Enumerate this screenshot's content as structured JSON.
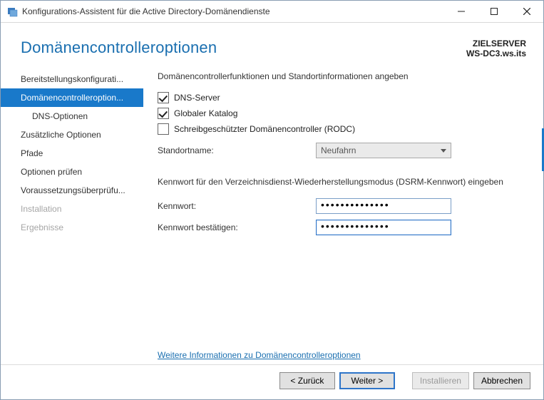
{
  "window": {
    "title": "Konfigurations-Assistent für die Active Directory-Domänendienste"
  },
  "header": {
    "title": "Domänencontrolleroptionen",
    "target_label": "ZIELSERVER",
    "target_value": "WS-DC3.ws.its"
  },
  "sidebar": {
    "items": [
      {
        "label": "Bereitstellungskonfigurati...",
        "selected": false,
        "disabled": false,
        "sub": false
      },
      {
        "label": "Domänencontrolleroption...",
        "selected": true,
        "disabled": false,
        "sub": false
      },
      {
        "label": "DNS-Optionen",
        "selected": false,
        "disabled": false,
        "sub": true
      },
      {
        "label": "Zusätzliche Optionen",
        "selected": false,
        "disabled": false,
        "sub": false
      },
      {
        "label": "Pfade",
        "selected": false,
        "disabled": false,
        "sub": false
      },
      {
        "label": "Optionen prüfen",
        "selected": false,
        "disabled": false,
        "sub": false
      },
      {
        "label": "Voraussetzungsüberprüfu...",
        "selected": false,
        "disabled": false,
        "sub": false
      },
      {
        "label": "Installation",
        "selected": false,
        "disabled": true,
        "sub": false
      },
      {
        "label": "Ergebnisse",
        "selected": false,
        "disabled": true,
        "sub": false
      }
    ]
  },
  "main": {
    "section1_title": "Domänencontrollerfunktionen und Standortinformationen angeben",
    "dns_label": "DNS-Server",
    "dns_checked": true,
    "gc_label": "Globaler Katalog",
    "gc_checked": true,
    "rodc_label": "Schreibgeschützter Domänencontroller (RODC)",
    "rodc_checked": false,
    "sitename_label": "Standortname:",
    "sitename_value": "Neufahrn",
    "section2_title": "Kennwort für den Verzeichnisdienst-Wiederherstellungsmodus (DSRM-Kennwort) eingeben",
    "pwd_label": "Kennwort:",
    "pwd_value": "••••••••••••••",
    "pwd2_label": "Kennwort bestätigen:",
    "pwd2_value": "••••••••••••••",
    "more_link": "Weitere Informationen zu Domänencontrolleroptionen"
  },
  "footer": {
    "back": "< Zurück",
    "next": "Weiter >",
    "install": "Installieren",
    "cancel": "Abbrechen"
  }
}
